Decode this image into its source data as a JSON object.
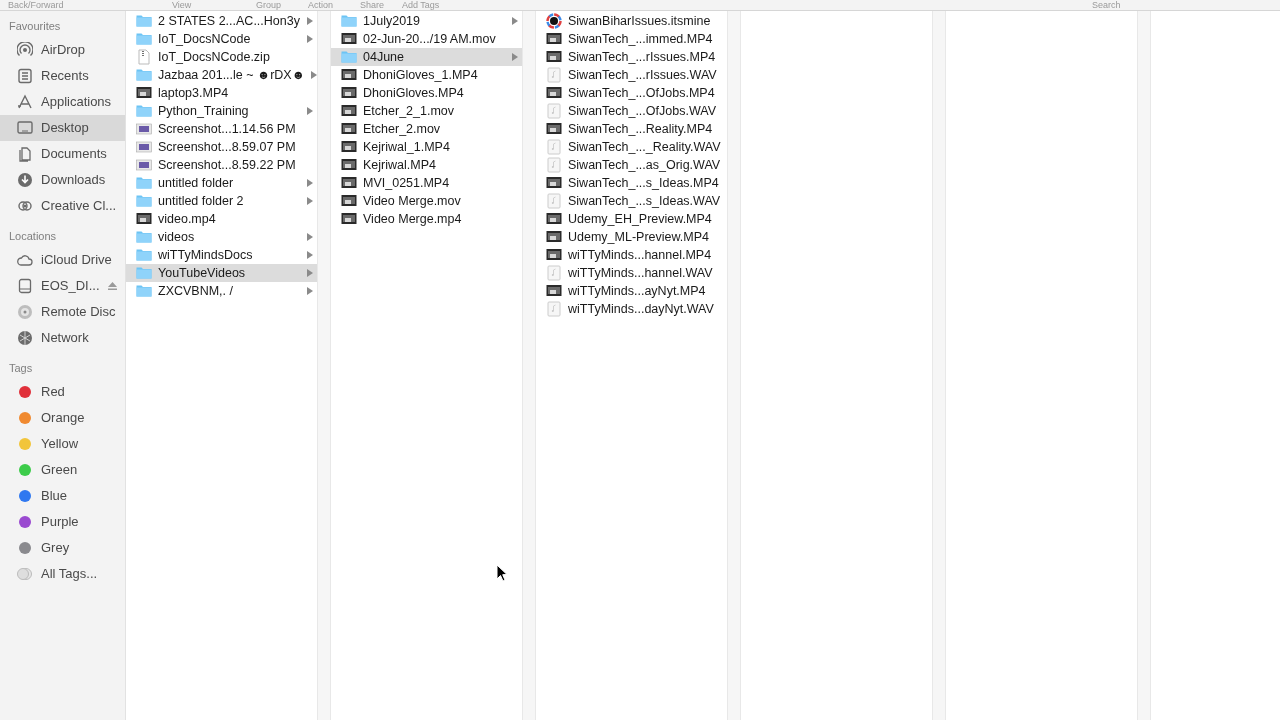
{
  "toolbar": {
    "labels": [
      "Back/Forward",
      "View",
      "Group",
      "Action",
      "Share",
      "Add Tags"
    ],
    "search_label": "Search"
  },
  "sidebar": {
    "sections": [
      {
        "title": "Favourites",
        "items": [
          {
            "label": "AirDrop",
            "kind": "airdrop",
            "selected": false
          },
          {
            "label": "Recents",
            "kind": "recents",
            "selected": false
          },
          {
            "label": "Applications",
            "kind": "applications",
            "selected": false
          },
          {
            "label": "Desktop",
            "kind": "desktop",
            "selected": true
          },
          {
            "label": "Documents",
            "kind": "documents",
            "selected": false
          },
          {
            "label": "Downloads",
            "kind": "downloads",
            "selected": false
          },
          {
            "label": "Creative Cl...",
            "kind": "creative",
            "selected": false
          }
        ]
      },
      {
        "title": "Locations",
        "items": [
          {
            "label": "iCloud Drive",
            "kind": "cloud",
            "selected": false
          },
          {
            "label": "EOS_DI...",
            "kind": "disk",
            "selected": false,
            "eject": true
          },
          {
            "label": "Remote Disc",
            "kind": "disc",
            "selected": false
          },
          {
            "label": "Network",
            "kind": "network",
            "selected": false
          }
        ]
      },
      {
        "title": "Tags",
        "items": [
          {
            "label": "Red",
            "kind": "tag",
            "color": "#e0303a",
            "selected": false
          },
          {
            "label": "Orange",
            "kind": "tag",
            "color": "#f08a30",
            "selected": false
          },
          {
            "label": "Yellow",
            "kind": "tag",
            "color": "#f2c53a",
            "selected": false
          },
          {
            "label": "Green",
            "kind": "tag",
            "color": "#3ccc4a",
            "selected": false
          },
          {
            "label": "Blue",
            "kind": "tag",
            "color": "#2f78f0",
            "selected": false
          },
          {
            "label": "Purple",
            "kind": "tag",
            "color": "#9a4ad0",
            "selected": false
          },
          {
            "label": "Grey",
            "kind": "tag",
            "color": "#8a8a8e",
            "selected": false
          },
          {
            "label": "All Tags...",
            "kind": "alltags",
            "selected": false
          }
        ]
      }
    ]
  },
  "columns": [
    {
      "items": [
        {
          "name": "2 STATES 2...AC...Hon3y",
          "kind": "folder",
          "selected": false
        },
        {
          "name": "IoT_DocsNCode",
          "kind": "folder",
          "selected": false
        },
        {
          "name": "IoT_DocsNCode.zip",
          "kind": "zip",
          "selected": false
        },
        {
          "name": "Jazbaa 201...le ~ ☻rDX☻",
          "kind": "folder",
          "selected": false
        },
        {
          "name": "laptop3.MP4",
          "kind": "video",
          "selected": false
        },
        {
          "name": "Python_Training",
          "kind": "folder",
          "selected": false
        },
        {
          "name": "Screenshot...1.14.56 PM",
          "kind": "image",
          "selected": false
        },
        {
          "name": "Screenshot...8.59.07 PM",
          "kind": "image",
          "selected": false
        },
        {
          "name": "Screenshot...8.59.22 PM",
          "kind": "image",
          "selected": false
        },
        {
          "name": "untitled folder",
          "kind": "folder",
          "selected": false
        },
        {
          "name": "untitled folder 2",
          "kind": "folder",
          "selected": false
        },
        {
          "name": "video.mp4",
          "kind": "video",
          "selected": false
        },
        {
          "name": "videos",
          "kind": "folder",
          "selected": false
        },
        {
          "name": "wiTTyMindsDocs",
          "kind": "folder",
          "selected": false
        },
        {
          "name": "YouTubeVideos",
          "kind": "folder",
          "selected": true
        },
        {
          "name": "ZXCVBNM,. /",
          "kind": "folder",
          "selected": false
        }
      ]
    },
    {
      "items": [
        {
          "name": "1July2019",
          "kind": "folder",
          "selected": false
        },
        {
          "name": "02-Jun-20.../19 AM.mov",
          "kind": "video",
          "selected": false
        },
        {
          "name": "04June",
          "kind": "folder",
          "selected": true
        },
        {
          "name": "DhoniGloves_1.MP4",
          "kind": "video",
          "selected": false
        },
        {
          "name": "DhoniGloves.MP4",
          "kind": "video",
          "selected": false
        },
        {
          "name": "Etcher_2_1.mov",
          "kind": "video",
          "selected": false
        },
        {
          "name": "Etcher_2.mov",
          "kind": "video",
          "selected": false
        },
        {
          "name": "Kejriwal_1.MP4",
          "kind": "video",
          "selected": false
        },
        {
          "name": "Kejriwal.MP4",
          "kind": "video",
          "selected": false
        },
        {
          "name": "MVI_0251.MP4",
          "kind": "video",
          "selected": false
        },
        {
          "name": "Video Merge.mov",
          "kind": "video",
          "selected": false
        },
        {
          "name": "Video Merge.mp4",
          "kind": "video",
          "selected": false
        }
      ]
    },
    {
      "items": [
        {
          "name": "SiwanBiharIssues.itsmine",
          "kind": "app",
          "selected": false
        },
        {
          "name": "SiwanTech_...immed.MP4",
          "kind": "video",
          "selected": false
        },
        {
          "name": "SiwanTech_...rIssues.MP4",
          "kind": "video",
          "selected": false
        },
        {
          "name": "SiwanTech_...rIssues.WAV",
          "kind": "audio",
          "selected": false
        },
        {
          "name": "SiwanTech_...OfJobs.MP4",
          "kind": "video",
          "selected": false
        },
        {
          "name": "SiwanTech_...OfJobs.WAV",
          "kind": "audio",
          "selected": false
        },
        {
          "name": "SiwanTech_...Reality.MP4",
          "kind": "video",
          "selected": false
        },
        {
          "name": "SiwanTech_..._Reality.WAV",
          "kind": "audio",
          "selected": false
        },
        {
          "name": "SiwanTech_...as_Orig.WAV",
          "kind": "audio",
          "selected": false
        },
        {
          "name": "SiwanTech_...s_Ideas.MP4",
          "kind": "video",
          "selected": false
        },
        {
          "name": "SiwanTech_...s_Ideas.WAV",
          "kind": "audio",
          "selected": false
        },
        {
          "name": "Udemy_EH_Preview.MP4",
          "kind": "video",
          "selected": false
        },
        {
          "name": "Udemy_ML-Preview.MP4",
          "kind": "video",
          "selected": false
        },
        {
          "name": "wiTTyMinds...hannel.MP4",
          "kind": "video",
          "selected": false
        },
        {
          "name": "wiTTyMinds...hannel.WAV",
          "kind": "audio",
          "selected": false
        },
        {
          "name": "wiTTyMinds...ayNyt.MP4",
          "kind": "video",
          "selected": false
        },
        {
          "name": "wiTTyMinds...dayNyt.WAV",
          "kind": "audio",
          "selected": false
        }
      ]
    }
  ]
}
